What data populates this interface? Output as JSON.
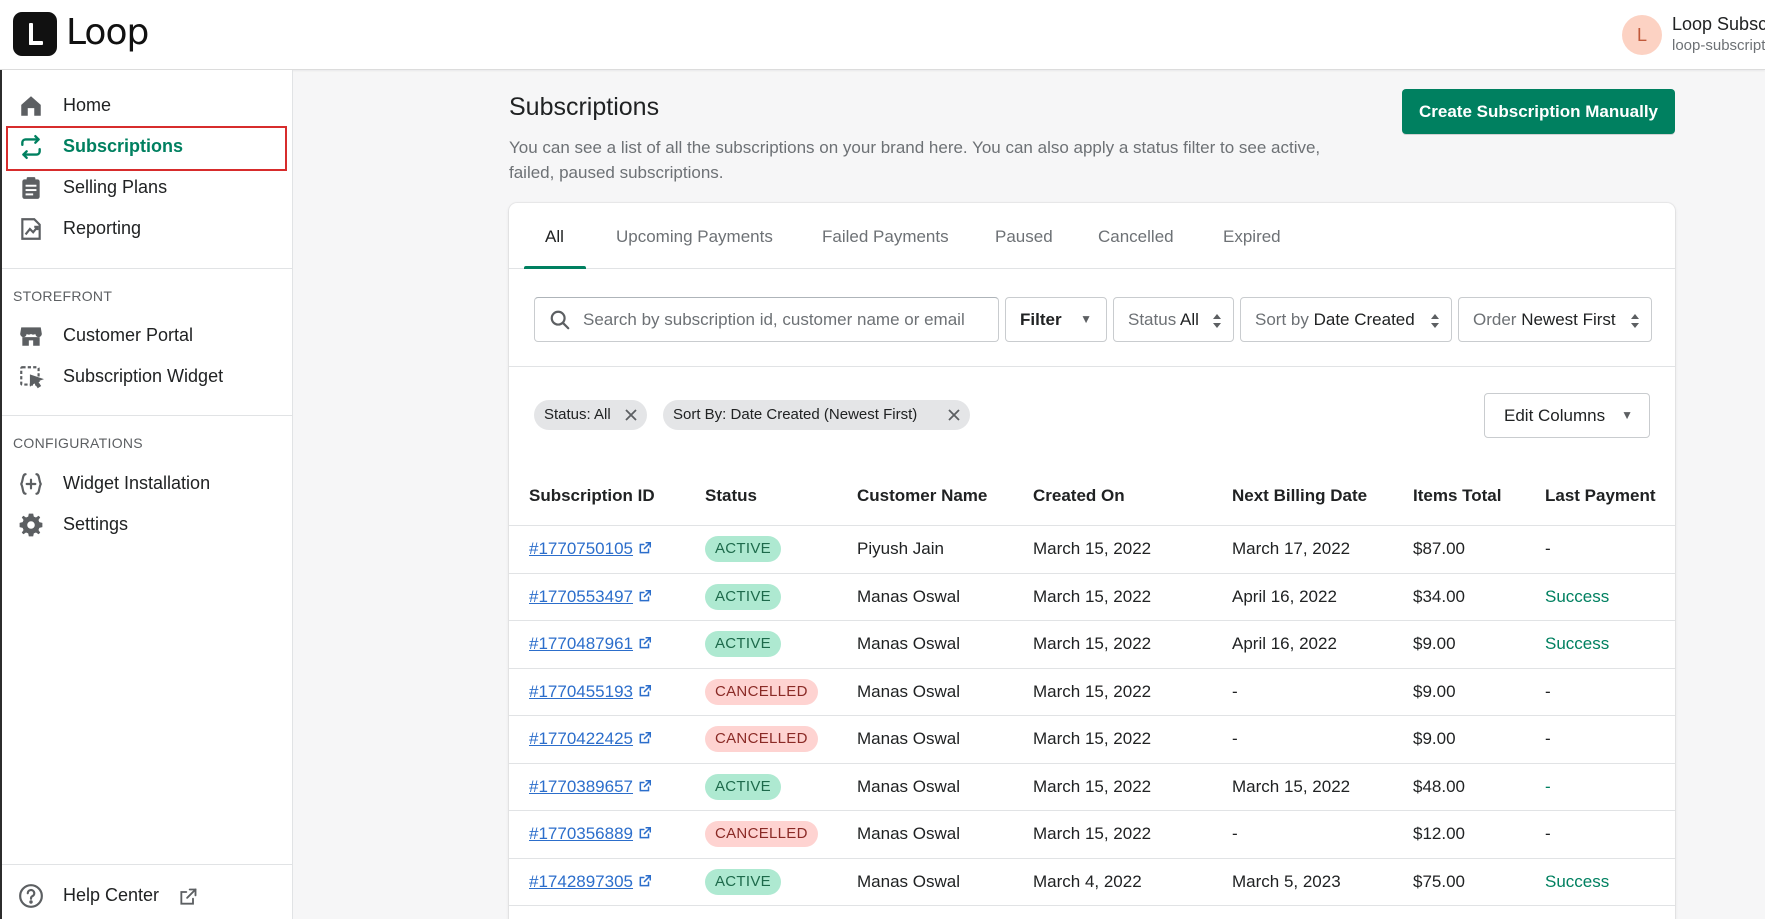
{
  "app": {
    "logo_text": "Loop",
    "account_initial": "L",
    "account_name": "Loop Subscriptions",
    "account_handle": "loop-subscriptions"
  },
  "sidebar": {
    "main_items": [
      {
        "label": "Home",
        "icon": "home-icon"
      },
      {
        "label": "Subscriptions",
        "icon": "refresh-arrows-icon",
        "active": true
      },
      {
        "label": "Selling Plans",
        "icon": "clipboard-icon"
      },
      {
        "label": "Reporting",
        "icon": "chart-icon"
      }
    ],
    "storefront_label": "STOREFRONT",
    "storefront_items": [
      {
        "label": "Customer Portal",
        "icon": "store-icon"
      },
      {
        "label": "Subscription Widget",
        "icon": "widget-icon"
      }
    ],
    "config_label": "CONFIGURATIONS",
    "config_items": [
      {
        "label": "Widget Installation",
        "icon": "code-braces-icon"
      },
      {
        "label": "Settings",
        "icon": "gear-icon"
      }
    ],
    "help_label": "Help Center"
  },
  "page": {
    "title": "Subscriptions",
    "description": "You can see a list of all the subscriptions on your brand here. You can also apply a status filter to see active, failed, paused subscriptions.",
    "create_button": "Create Subscription Manually"
  },
  "tabs": [
    "All",
    "Upcoming Payments",
    "Failed Payments",
    "Paused",
    "Cancelled",
    "Expired"
  ],
  "filters": {
    "search_placeholder": "Search by subscription id, customer name or email",
    "filter_label": "Filter",
    "status_prefix": "Status",
    "status_value": "All",
    "sort_prefix": "Sort by",
    "sort_value": "Date Created",
    "order_prefix": "Order",
    "order_value": "Newest First"
  },
  "chips": [
    "Status: All",
    "Sort By: Date Created (Newest First)"
  ],
  "edit_columns_label": "Edit Columns",
  "table": {
    "headers": [
      "Subscription ID",
      "Status",
      "Customer Name",
      "Created On",
      "Next Billing Date",
      "Items Total",
      "Last Payment"
    ],
    "rows": [
      {
        "id": "#1770750105",
        "status": "ACTIVE",
        "customer": "Piyush Jain",
        "created": "March 15, 2022",
        "next_billing": "March 17, 2022",
        "total": "$87.00",
        "last_payment": "-"
      },
      {
        "id": "#1770553497",
        "status": "ACTIVE",
        "customer": "Manas Oswal",
        "created": "March 15, 2022",
        "next_billing": "April 16, 2022",
        "total": "$34.00",
        "last_payment": "Success"
      },
      {
        "id": "#1770487961",
        "status": "ACTIVE",
        "customer": "Manas Oswal",
        "created": "March 15, 2022",
        "next_billing": "April 16, 2022",
        "total": "$9.00",
        "last_payment": "Success"
      },
      {
        "id": "#1770455193",
        "status": "CANCELLED",
        "customer": "Manas Oswal",
        "created": "March 15, 2022",
        "next_billing": "-",
        "total": "$9.00",
        "last_payment": "-"
      },
      {
        "id": "#1770422425",
        "status": "CANCELLED",
        "customer": "Manas Oswal",
        "created": "March 15, 2022",
        "next_billing": "-",
        "total": "$9.00",
        "last_payment": "-"
      },
      {
        "id": "#1770389657",
        "status": "ACTIVE",
        "customer": "Manas Oswal",
        "created": "March 15, 2022",
        "next_billing": "March 15, 2022",
        "total": "$48.00",
        "last_payment": "-"
      },
      {
        "id": "#1770356889",
        "status": "CANCELLED",
        "customer": "Manas Oswal",
        "created": "March 15, 2022",
        "next_billing": "-",
        "total": "$12.00",
        "last_payment": "-"
      },
      {
        "id": "#1742897305",
        "status": "ACTIVE",
        "customer": "Manas Oswal",
        "created": "March 4, 2022",
        "next_billing": "March 5, 2023",
        "total": "$75.00",
        "last_payment": "Success"
      }
    ]
  },
  "colors": {
    "primary": "#008060",
    "link": "#2c6ecb",
    "active_badge": "#aee9d1",
    "cancelled_badge": "#fed3d1",
    "highlight": "#d72c2c"
  }
}
